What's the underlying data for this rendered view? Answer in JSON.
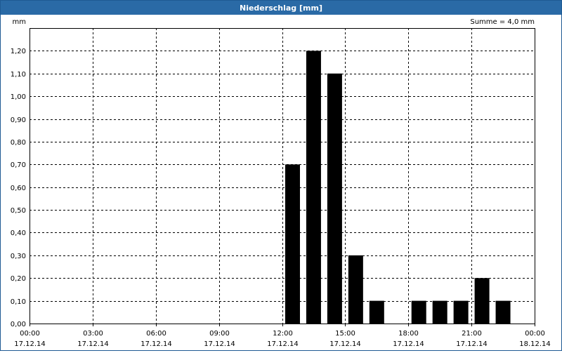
{
  "window": {
    "title": "Niederschlag [mm]"
  },
  "chart_data": {
    "type": "bar",
    "unit_label": "mm",
    "sum_label": "Summe = 4,0 mm",
    "ylim": [
      0,
      1.3
    ],
    "y_ticks": [
      "0,00",
      "0,10",
      "0,20",
      "0,30",
      "0,40",
      "0,50",
      "0,60",
      "0,70",
      "0,80",
      "0,90",
      "1,00",
      "1,10",
      "1,20"
    ],
    "x_tick_labels": [
      {
        "time": "00:00",
        "date": "17.12.14"
      },
      {
        "time": "03:00",
        "date": "17.12.14"
      },
      {
        "time": "06:00",
        "date": "17.12.14"
      },
      {
        "time": "09:00",
        "date": "17.12.14"
      },
      {
        "time": "12:00",
        "date": "17.12.14"
      },
      {
        "time": "15:00",
        "date": "17.12.14"
      },
      {
        "time": "18:00",
        "date": "17.12.14"
      },
      {
        "time": "21:00",
        "date": "17.12.14"
      },
      {
        "time": "00:00",
        "date": "18.12.14"
      }
    ],
    "x_range_hours": [
      0,
      24
    ],
    "bars": [
      {
        "hour": 12,
        "value": 0.7
      },
      {
        "hour": 13,
        "value": 1.2
      },
      {
        "hour": 14,
        "value": 1.1
      },
      {
        "hour": 15,
        "value": 0.3
      },
      {
        "hour": 16,
        "value": 0.1
      },
      {
        "hour": 17,
        "value": 0.0
      },
      {
        "hour": 18,
        "value": 0.1
      },
      {
        "hour": 19,
        "value": 0.1
      },
      {
        "hour": 20,
        "value": 0.1
      },
      {
        "hour": 21,
        "value": 0.2
      },
      {
        "hour": 22,
        "value": 0.1
      }
    ],
    "bar_color": "#000000",
    "grid": true,
    "grid_style": "dashed"
  }
}
